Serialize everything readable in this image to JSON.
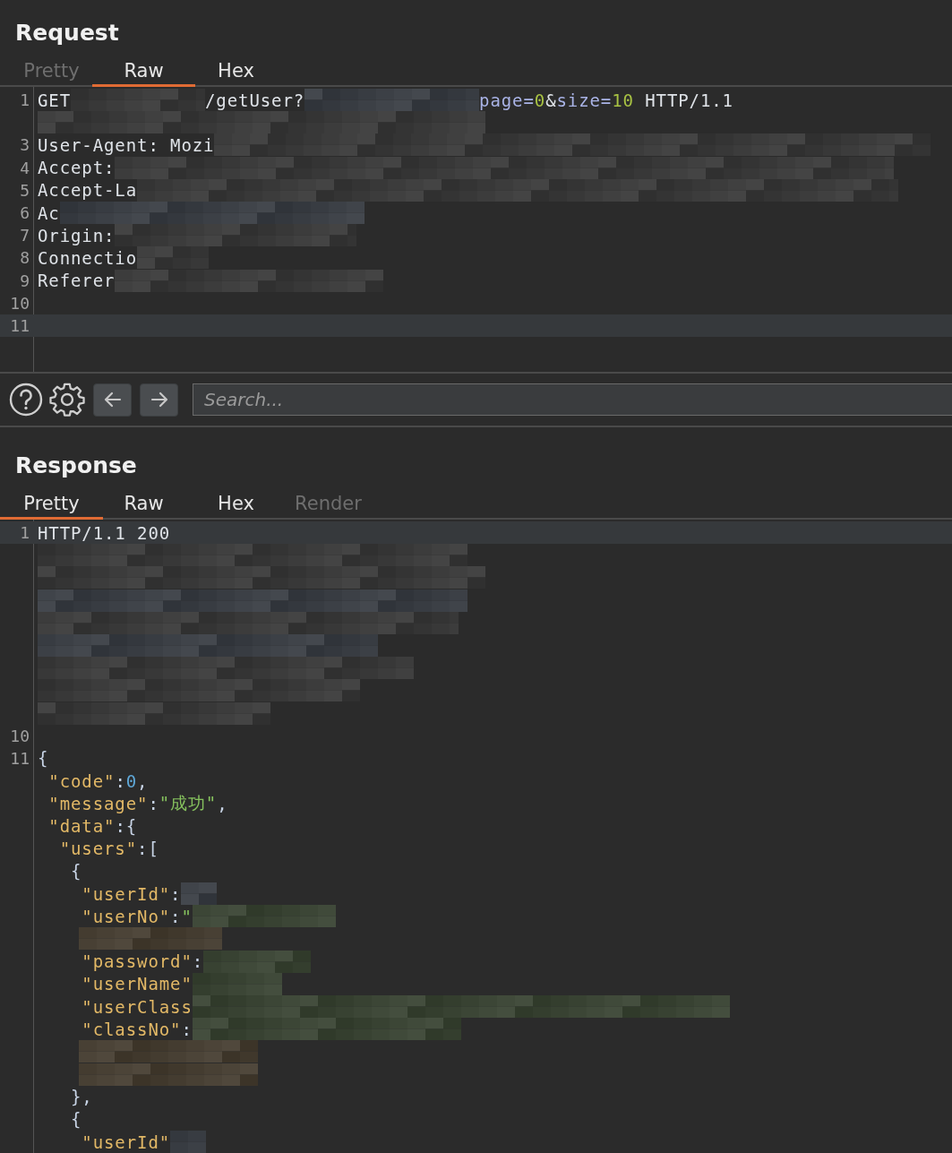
{
  "request": {
    "title": "Request",
    "tabs": [
      {
        "label": "Pretty",
        "selected": false,
        "disabled": true
      },
      {
        "label": "Raw",
        "selected": true,
        "disabled": false
      },
      {
        "label": "Hex",
        "selected": false,
        "disabled": false
      }
    ],
    "lines": [
      {
        "number": "1",
        "current": false,
        "tokens": [
          {
            "kind": "plain",
            "text": "GET"
          },
          {
            "kind": "redacted"
          },
          {
            "kind": "plain",
            "text": "/getUser?"
          },
          {
            "kind": "redacted"
          },
          {
            "kind": "param",
            "text": "page="
          },
          {
            "kind": "value",
            "text": "0"
          },
          {
            "kind": "plain",
            "text": "&"
          },
          {
            "kind": "param",
            "text": "size="
          },
          {
            "kind": "value",
            "text": "10"
          },
          {
            "kind": "plain",
            "text": " HTTP/1.1"
          }
        ]
      },
      {
        "current": false,
        "tokens": [
          {
            "kind": "redacted"
          }
        ]
      },
      {
        "number": "3",
        "current": false,
        "tokens": [
          {
            "kind": "plain",
            "text": "User-Agent: Mozi"
          },
          {
            "kind": "redacted"
          }
        ]
      },
      {
        "number": "4",
        "current": false,
        "tokens": [
          {
            "kind": "plain",
            "text": "Accept:"
          },
          {
            "kind": "redacted"
          }
        ]
      },
      {
        "number": "5",
        "current": false,
        "tokens": [
          {
            "kind": "plain",
            "text": "Accept-La"
          },
          {
            "kind": "redacted"
          }
        ]
      },
      {
        "number": "6",
        "current": false,
        "tokens": [
          {
            "kind": "plain",
            "text": "Ac"
          },
          {
            "kind": "redacted"
          }
        ]
      },
      {
        "number": "7",
        "current": false,
        "tokens": [
          {
            "kind": "plain",
            "text": "Origin:"
          },
          {
            "kind": "redacted"
          }
        ]
      },
      {
        "number": "8",
        "current": false,
        "tokens": [
          {
            "kind": "plain",
            "text": "Connectio"
          },
          {
            "kind": "redacted"
          }
        ]
      },
      {
        "number": "9",
        "current": false,
        "tokens": [
          {
            "kind": "plain",
            "text": "Referer"
          },
          {
            "kind": "redacted"
          }
        ]
      },
      {
        "number": "10",
        "current": false
      },
      {
        "number": "11",
        "current": true
      }
    ]
  },
  "toolbar": {
    "search": {
      "placeholder": "Search..."
    }
  },
  "response": {
    "title": "Response",
    "tabs": [
      {
        "label": "Pretty",
        "selected": true,
        "disabled": false
      },
      {
        "label": "Raw",
        "selected": false,
        "disabled": false
      },
      {
        "label": "Hex",
        "selected": false,
        "disabled": false
      },
      {
        "label": "Render",
        "selected": false,
        "disabled": true
      }
    ],
    "lines": [
      {
        "number": "1",
        "current": true,
        "tokens": [
          {
            "kind": "plain",
            "text": "HTTP/1.1 200"
          }
        ]
      },
      {
        "current": false,
        "tokens": [
          {
            "kind": "redacted"
          }
        ]
      },
      {
        "current": false,
        "tokens": [
          {
            "kind": "redacted"
          }
        ]
      },
      {
        "current": false,
        "tokens": [
          {
            "kind": "redacted"
          }
        ]
      },
      {
        "current": false,
        "tokens": [
          {
            "kind": "redacted"
          }
        ]
      },
      {
        "current": false,
        "tokens": [
          {
            "kind": "redacted"
          }
        ]
      },
      {
        "current": false,
        "tokens": [
          {
            "kind": "redacted"
          }
        ]
      },
      {
        "current": false,
        "tokens": [
          {
            "kind": "redacted"
          }
        ]
      },
      {
        "current": false,
        "tokens": [
          {
            "kind": "redacted"
          }
        ]
      },
      {
        "number": "10",
        "current": false
      },
      {
        "number": "11",
        "current": false,
        "tokens": [
          {
            "kind": "punct",
            "text": "{"
          }
        ]
      },
      {
        "current": false,
        "tokens": [
          {
            "kind": "key",
            "text": " \"code\""
          },
          {
            "kind": "punct",
            "text": ":"
          },
          {
            "kind": "number",
            "text": "0"
          },
          {
            "kind": "punct",
            "text": ","
          }
        ]
      },
      {
        "current": false,
        "tokens": [
          {
            "kind": "key",
            "text": " \"message\""
          },
          {
            "kind": "punct",
            "text": ":"
          },
          {
            "kind": "string",
            "text": "\"成功\""
          },
          {
            "kind": "punct",
            "text": ","
          }
        ]
      },
      {
        "current": false,
        "tokens": [
          {
            "kind": "key",
            "text": " \"data\""
          },
          {
            "kind": "punct",
            "text": ":{"
          }
        ]
      },
      {
        "current": false,
        "tokens": [
          {
            "kind": "key",
            "text": "  \"users\""
          },
          {
            "kind": "punct",
            "text": ":["
          }
        ]
      },
      {
        "current": false,
        "tokens": [
          {
            "kind": "punct",
            "text": "   {"
          }
        ]
      },
      {
        "current": false,
        "tokens": [
          {
            "kind": "key",
            "text": "    \"userId\""
          },
          {
            "kind": "punct",
            "text": ":"
          },
          {
            "kind": "redacted"
          }
        ]
      },
      {
        "current": false,
        "tokens": [
          {
            "kind": "key",
            "text": "    \"userNo\""
          },
          {
            "kind": "punct",
            "text": ":"
          },
          {
            "kind": "string",
            "text": "\""
          },
          {
            "kind": "redacted"
          }
        ]
      },
      {
        "current": false,
        "tokens": [
          {
            "kind": "redacted"
          }
        ]
      },
      {
        "current": false,
        "tokens": [
          {
            "kind": "key",
            "text": "    \"password\""
          },
          {
            "kind": "punct",
            "text": ":"
          },
          {
            "kind": "redacted"
          }
        ]
      },
      {
        "current": false,
        "tokens": [
          {
            "kind": "key",
            "text": "    \"userName\""
          },
          {
            "kind": "redacted"
          }
        ]
      },
      {
        "current": false,
        "tokens": [
          {
            "kind": "key",
            "text": "    \"userClass"
          },
          {
            "kind": "redacted"
          }
        ]
      },
      {
        "current": false,
        "tokens": [
          {
            "kind": "key",
            "text": "    \"classNo\""
          },
          {
            "kind": "punct",
            "text": ":"
          },
          {
            "kind": "redacted"
          }
        ]
      },
      {
        "current": false,
        "tokens": [
          {
            "kind": "redacted"
          }
        ]
      },
      {
        "current": false,
        "tokens": [
          {
            "kind": "redacted"
          }
        ]
      },
      {
        "current": false,
        "tokens": [
          {
            "kind": "punct",
            "text": "   },"
          }
        ]
      },
      {
        "current": false,
        "tokens": [
          {
            "kind": "punct",
            "text": "   {"
          }
        ]
      },
      {
        "current": false,
        "tokens": [
          {
            "kind": "key",
            "text": "    \"userId\""
          },
          {
            "kind": "redacted"
          }
        ]
      }
    ]
  }
}
